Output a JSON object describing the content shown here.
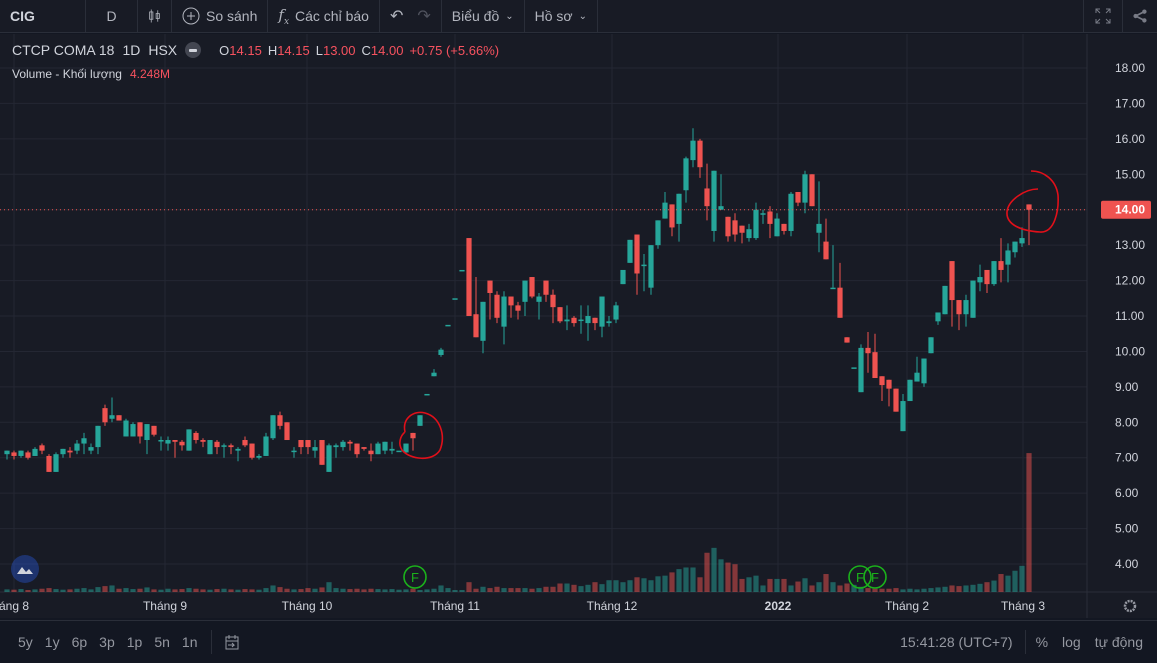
{
  "toolbar": {
    "symbol": "CIG",
    "interval": "D",
    "compare": "So sánh",
    "indicators": "Các chỉ báo",
    "chart": "Biểu đồ",
    "profile": "Hồ sơ",
    "icons": [
      "candles-icon",
      "plus-circle-icon",
      "fx-icon",
      "undo-icon",
      "redo-icon",
      "fullscreen-icon",
      "share-icon"
    ]
  },
  "legend": {
    "name": "CTCP COMA 18",
    "interval": "1D",
    "exchange": "HSX",
    "o_label": "O",
    "o": "14.15",
    "h_label": "H",
    "h": "14.15",
    "l_label": "L",
    "l": "13.00",
    "c_label": "C",
    "c": "14.00",
    "change": "+0.75 (+5.66%)",
    "volume_label": "Volume - Khối lượng",
    "volume": "4.248M"
  },
  "colors": {
    "up": "#26a69a",
    "down": "#ef5350",
    "bg": "#181b25",
    "annotation": "#e0101a",
    "marker": "#1bb21b"
  },
  "price_axis": [
    "18.00",
    "17.00",
    "16.00",
    "15.00",
    "14.00",
    "13.00",
    "12.00",
    "11.00",
    "10.00",
    "9.00",
    "8.00",
    "7.00",
    "6.00",
    "5.00",
    "4.00"
  ],
  "last_price": "14.00",
  "time_axis": [
    "áng 8",
    "Tháng 9",
    "Tháng 10",
    "Tháng 11",
    "Tháng 12",
    "2022",
    "Tháng 2",
    "Tháng 3"
  ],
  "markers": [
    "F",
    "F",
    "F"
  ],
  "bottom": {
    "ranges": [
      "5y",
      "1y",
      "6p",
      "3p",
      "1p",
      "5n",
      "1n"
    ],
    "time": "15:41:28 (UTC+7)",
    "percent": "%",
    "log": "log",
    "auto": "tự động"
  },
  "chart_data": {
    "type": "candlestick",
    "ylim": [
      3.6,
      18.4
    ],
    "volume_unit": "M",
    "ohlc": [
      [
        7.1,
        7.2,
        6.95,
        7.2
      ],
      [
        7.15,
        7.2,
        6.95,
        7.05
      ],
      [
        7.05,
        7.2,
        7.0,
        7.2
      ],
      [
        7.15,
        7.2,
        6.95,
        7.0
      ],
      [
        7.05,
        7.3,
        7.05,
        7.25
      ],
      [
        7.35,
        7.4,
        7.1,
        7.2
      ],
      [
        7.05,
        7.1,
        6.6,
        6.6
      ],
      [
        6.6,
        7.15,
        6.6,
        7.1
      ],
      [
        7.1,
        7.25,
        7.0,
        7.25
      ],
      [
        7.2,
        7.3,
        7.0,
        7.15
      ],
      [
        7.2,
        7.5,
        7.1,
        7.4
      ],
      [
        7.4,
        7.7,
        7.1,
        7.55
      ],
      [
        7.2,
        7.4,
        7.1,
        7.3
      ],
      [
        7.3,
        7.9,
        7.1,
        7.9
      ],
      [
        8.4,
        8.5,
        7.9,
        8.0
      ],
      [
        8.1,
        8.7,
        8.0,
        8.2
      ],
      [
        8.2,
        8.2,
        8.05,
        8.05
      ],
      [
        7.6,
        8.1,
        7.6,
        8.05
      ],
      [
        7.6,
        8.0,
        7.6,
        7.95
      ],
      [
        8.0,
        8.0,
        7.4,
        7.6
      ],
      [
        7.5,
        7.9,
        7.1,
        7.95
      ],
      [
        7.9,
        7.9,
        7.6,
        7.65
      ],
      [
        7.5,
        7.6,
        7.2,
        7.5
      ],
      [
        7.4,
        7.6,
        7.2,
        7.5
      ],
      [
        7.5,
        7.5,
        7.0,
        7.45
      ],
      [
        7.45,
        7.5,
        7.2,
        7.35
      ],
      [
        7.2,
        7.8,
        7.2,
        7.8
      ],
      [
        7.7,
        7.75,
        7.4,
        7.5
      ],
      [
        7.5,
        7.55,
        7.3,
        7.45
      ],
      [
        7.1,
        7.5,
        7.1,
        7.5
      ],
      [
        7.45,
        7.5,
        7.1,
        7.3
      ],
      [
        7.35,
        7.4,
        7.0,
        7.35
      ],
      [
        7.35,
        7.4,
        7.1,
        7.3
      ],
      [
        7.2,
        7.3,
        6.9,
        7.25
      ],
      [
        7.5,
        7.6,
        7.3,
        7.35
      ],
      [
        7.4,
        7.4,
        6.95,
        7.0
      ],
      [
        7.0,
        7.1,
        6.95,
        7.05
      ],
      [
        7.05,
        7.7,
        7.05,
        7.6
      ],
      [
        7.55,
        8.2,
        7.5,
        8.2
      ],
      [
        8.2,
        8.3,
        7.8,
        7.9
      ],
      [
        8.0,
        8.0,
        7.5,
        7.5
      ],
      [
        7.2,
        7.3,
        7.0,
        7.2
      ],
      [
        7.5,
        7.5,
        7.1,
        7.3
      ],
      [
        7.5,
        7.5,
        7.1,
        7.3
      ],
      [
        7.2,
        7.5,
        7.0,
        7.3
      ],
      [
        7.5,
        7.5,
        6.8,
        6.8
      ],
      [
        6.6,
        7.4,
        6.6,
        7.35
      ],
      [
        7.3,
        7.4,
        7.0,
        7.35
      ],
      [
        7.3,
        7.5,
        7.2,
        7.45
      ],
      [
        7.45,
        7.5,
        7.2,
        7.4
      ],
      [
        7.4,
        7.4,
        7.0,
        7.1
      ],
      [
        7.3,
        7.3,
        7.2,
        7.25
      ],
      [
        7.2,
        7.4,
        6.9,
        7.1
      ],
      [
        7.1,
        7.45,
        7.1,
        7.4
      ],
      [
        7.2,
        7.45,
        7.1,
        7.45
      ],
      [
        7.2,
        7.45,
        7.1,
        7.25
      ],
      [
        7.2,
        7.2,
        7.2,
        7.2
      ],
      [
        7.15,
        7.4,
        7.1,
        7.4
      ],
      [
        7.7,
        7.7,
        7.2,
        7.55
      ],
      [
        7.9,
        8.2,
        7.9,
        8.2
      ],
      [
        8.8,
        8.8,
        8.8,
        8.8
      ],
      [
        9.3,
        9.5,
        9.3,
        9.4
      ],
      [
        9.9,
        10.1,
        9.85,
        10.05
      ],
      [
        10.75,
        10.75,
        10.75,
        10.75
      ],
      [
        11.5,
        11.5,
        11.5,
        11.5
      ],
      [
        12.3,
        12.3,
        12.3,
        12.3
      ],
      [
        13.2,
        13.2,
        11.0,
        11.0
      ],
      [
        11.05,
        12.1,
        10.4,
        10.4
      ],
      [
        10.3,
        11.4,
        9.95,
        11.4
      ],
      [
        12.0,
        12.0,
        10.9,
        11.65
      ],
      [
        11.6,
        11.7,
        10.8,
        10.95
      ],
      [
        10.7,
        11.7,
        10.2,
        11.55
      ],
      [
        11.55,
        11.55,
        10.95,
        11.3
      ],
      [
        11.3,
        11.4,
        10.9,
        11.15
      ],
      [
        11.4,
        12.0,
        11.0,
        12.0
      ],
      [
        12.1,
        12.1,
        11.5,
        11.55
      ],
      [
        11.4,
        11.65,
        10.9,
        11.55
      ],
      [
        12.0,
        12.0,
        11.4,
        11.6
      ],
      [
        11.6,
        11.75,
        10.8,
        11.25
      ],
      [
        11.25,
        11.25,
        10.8,
        10.85
      ],
      [
        10.85,
        11.3,
        10.6,
        10.9
      ],
      [
        10.95,
        11.0,
        10.7,
        10.8
      ],
      [
        10.9,
        11.3,
        10.5,
        10.9
      ],
      [
        10.8,
        11.3,
        10.3,
        11.0
      ],
      [
        10.95,
        10.95,
        10.6,
        10.8
      ],
      [
        10.7,
        11.55,
        10.4,
        11.55
      ],
      [
        10.8,
        11.0,
        10.7,
        10.85
      ],
      [
        10.9,
        11.4,
        10.8,
        11.3
      ],
      [
        11.9,
        12.3,
        11.9,
        12.3
      ],
      [
        12.5,
        13.15,
        12.5,
        13.15
      ],
      [
        13.3,
        13.3,
        11.6,
        12.2
      ],
      [
        12.45,
        12.75,
        11.7,
        12.45
      ],
      [
        11.8,
        13.0,
        11.6,
        13.0
      ],
      [
        13.0,
        13.7,
        12.9,
        13.7
      ],
      [
        13.75,
        14.5,
        13.75,
        14.2
      ],
      [
        14.15,
        14.15,
        13.25,
        13.5
      ],
      [
        13.6,
        14.45,
        13.1,
        14.45
      ],
      [
        14.55,
        15.5,
        14.2,
        15.45
      ],
      [
        15.4,
        16.3,
        15.2,
        15.95
      ],
      [
        15.95,
        16.0,
        14.9,
        15.2
      ],
      [
        14.6,
        15.3,
        13.7,
        14.1
      ],
      [
        13.4,
        15.1,
        13.1,
        15.1
      ],
      [
        14.0,
        15.0,
        14.0,
        14.1
      ],
      [
        13.8,
        13.8,
        13.1,
        13.25
      ],
      [
        13.7,
        13.9,
        13.1,
        13.3
      ],
      [
        13.55,
        13.55,
        13.05,
        13.35
      ],
      [
        13.2,
        13.6,
        13.1,
        13.45
      ],
      [
        13.2,
        14.2,
        13.15,
        14.0
      ],
      [
        13.9,
        14.0,
        13.6,
        13.9
      ],
      [
        13.95,
        14.1,
        13.2,
        13.6
      ],
      [
        13.25,
        13.9,
        13.25,
        13.75
      ],
      [
        13.6,
        13.6,
        13.3,
        13.4
      ],
      [
        13.4,
        14.5,
        13.25,
        14.45
      ],
      [
        14.5,
        14.5,
        14.1,
        14.2
      ],
      [
        14.2,
        15.1,
        13.9,
        15.0
      ],
      [
        15.0,
        15.0,
        14.1,
        14.1
      ],
      [
        13.35,
        14.8,
        12.8,
        13.6
      ],
      [
        13.1,
        13.75,
        12.6,
        12.6
      ],
      [
        11.8,
        13.0,
        11.8,
        11.8
      ],
      [
        11.8,
        12.5,
        10.95,
        10.95
      ],
      [
        10.4,
        10.4,
        10.25,
        10.25
      ],
      [
        9.55,
        9.55,
        9.55,
        9.55
      ],
      [
        8.85,
        10.2,
        8.85,
        10.1
      ],
      [
        10.1,
        10.55,
        9.4,
        9.95
      ],
      [
        9.98,
        10.5,
        9.25,
        9.25
      ],
      [
        9.3,
        9.3,
        8.6,
        9.05
      ],
      [
        9.2,
        9.2,
        8.45,
        8.95
      ],
      [
        8.95,
        8.95,
        8.3,
        8.3
      ],
      [
        7.75,
        8.8,
        7.75,
        8.6
      ],
      [
        8.6,
        9.2,
        8.6,
        9.2
      ],
      [
        9.15,
        9.85,
        9.15,
        9.4
      ],
      [
        9.1,
        9.8,
        9.0,
        9.8
      ],
      [
        9.95,
        10.4,
        9.95,
        10.4
      ],
      [
        10.85,
        11.1,
        10.75,
        11.1
      ],
      [
        11.05,
        11.85,
        11.05,
        11.85
      ],
      [
        12.55,
        12.55,
        10.7,
        11.45
      ],
      [
        11.45,
        11.45,
        10.6,
        11.05
      ],
      [
        11.05,
        11.6,
        10.7,
        11.45
      ],
      [
        10.95,
        12.0,
        10.95,
        12.0
      ],
      [
        11.95,
        12.45,
        11.7,
        12.1
      ],
      [
        12.3,
        12.3,
        11.65,
        11.9
      ],
      [
        11.9,
        12.55,
        11.85,
        12.55
      ],
      [
        12.55,
        13.2,
        11.95,
        12.3
      ],
      [
        12.45,
        13.05,
        11.95,
        12.85
      ],
      [
        12.8,
        13.1,
        12.65,
        13.1
      ],
      [
        13.05,
        13.5,
        12.95,
        13.2
      ],
      [
        14.15,
        14.15,
        13.0,
        14.0
      ]
    ],
    "volume": [
      0.08,
      0.07,
      0.09,
      0.06,
      0.08,
      0.1,
      0.12,
      0.09,
      0.07,
      0.08,
      0.1,
      0.12,
      0.08,
      0.15,
      0.18,
      0.2,
      0.1,
      0.12,
      0.09,
      0.1,
      0.14,
      0.08,
      0.07,
      0.1,
      0.08,
      0.09,
      0.12,
      0.1,
      0.08,
      0.07,
      0.09,
      0.1,
      0.08,
      0.07,
      0.09,
      0.08,
      0.07,
      0.12,
      0.2,
      0.15,
      0.1,
      0.08,
      0.09,
      0.12,
      0.1,
      0.14,
      0.3,
      0.12,
      0.1,
      0.09,
      0.1,
      0.08,
      0.1,
      0.09,
      0.08,
      0.09,
      0.07,
      0.08,
      0.1,
      0.06,
      0.08,
      0.1,
      0.2,
      0.12,
      0.06,
      0.05,
      0.3,
      0.1,
      0.16,
      0.12,
      0.16,
      0.12,
      0.12,
      0.12,
      0.12,
      0.1,
      0.12,
      0.16,
      0.16,
      0.26,
      0.26,
      0.22,
      0.18,
      0.22,
      0.3,
      0.24,
      0.36,
      0.36,
      0.3,
      0.36,
      0.45,
      0.42,
      0.36,
      0.48,
      0.5,
      0.6,
      0.7,
      0.75,
      0.75,
      0.45,
      1.2,
      1.35,
      1.0,
      0.9,
      0.85,
      0.4,
      0.45,
      0.5,
      0.2,
      0.4,
      0.4,
      0.4,
      0.2,
      0.32,
      0.42,
      0.2,
      0.3,
      0.55,
      0.3,
      0.2,
      0.26,
      0.22,
      0.16,
      0.12,
      0.1,
      0.1,
      0.1,
      0.12,
      0.08,
      0.1,
      0.08,
      0.1,
      0.12,
      0.14,
      0.16,
      0.2,
      0.18,
      0.2,
      0.22,
      0.25,
      0.3,
      0.35,
      0.55,
      0.5,
      0.65,
      0.8,
      4.248
    ]
  }
}
